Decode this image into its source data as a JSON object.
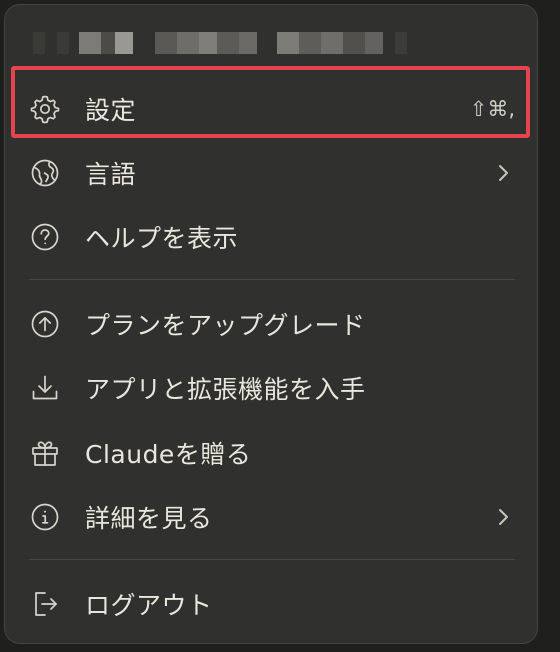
{
  "menu": {
    "items": [
      {
        "label": "設定",
        "shortcut": "⇧⌘,",
        "icon": "gear-icon"
      },
      {
        "label": "言語",
        "icon": "globe-icon",
        "submenu": true
      },
      {
        "label": "ヘルプを表示",
        "icon": "help-circle-icon"
      },
      {
        "label": "プランをアップグレード",
        "icon": "arrow-up-circle-icon"
      },
      {
        "label": "アプリと拡張機能を入手",
        "icon": "download-icon"
      },
      {
        "label": "Claudeを贈る",
        "icon": "gift-icon"
      },
      {
        "label": "詳細を見る",
        "icon": "info-circle-icon",
        "submenu": true
      },
      {
        "label": "ログアウト",
        "icon": "logout-icon"
      }
    ]
  },
  "colors": {
    "menu_background": "#30302e",
    "text": "#e9e6dc",
    "highlight_border": "#e5444f"
  }
}
